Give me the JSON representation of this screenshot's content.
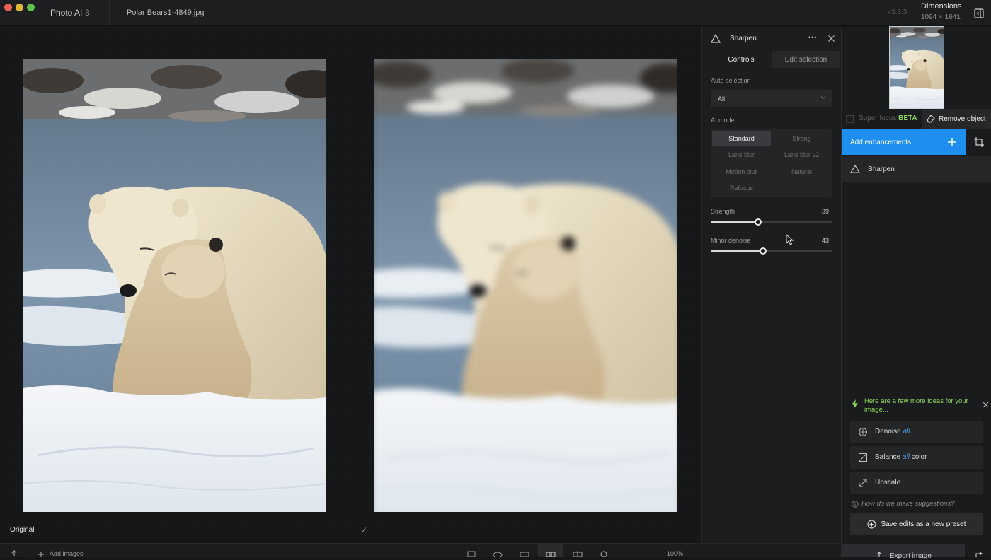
{
  "titlebar": {
    "app_name": "Photo AI",
    "image_count": "3",
    "file_name": "Polar Bears1-4849.jpg",
    "version": "v3.3.3",
    "dimensions_label": "Dimensions",
    "dimensions_value": "1094 × 1641"
  },
  "canvas": {
    "original_label": "Original",
    "check": "✓"
  },
  "bottombar": {
    "add_images": "Add images",
    "zoom": "100%"
  },
  "sharpen_panel": {
    "title": "Sharpen",
    "more": "•••",
    "tabs": {
      "controls": "Controls",
      "edit_selection": "Edit selection"
    },
    "auto_selection_label": "Auto selection",
    "auto_selection_value": "All",
    "ai_model_label": "AI model",
    "models": [
      "Standard",
      "Strong",
      "Lens blur",
      "Lens blur v2",
      "Motion blur",
      "Natural",
      "Refocus"
    ],
    "selected_model": "Standard",
    "strength_label": "Strength",
    "strength_value": "39",
    "strength_level": 0.39,
    "denoise_label": "Minor denoise",
    "denoise_value": "43",
    "denoise_level": 0.43
  },
  "right_panel": {
    "super_focus": "Super focus",
    "beta": "BETA",
    "remove_object": "Remove object",
    "add_enhancements": "Add enhancements",
    "enhancement_item": "Sharpen",
    "ideas_title": "Here are a few more ideas for your image...",
    "ideas": [
      {
        "label": "Denoise",
        "tag": "all",
        "suffix": "",
        "icon": "denoise-icon"
      },
      {
        "label": "Balance",
        "tag": "all",
        "suffix": "color",
        "icon": "balance-color-icon"
      },
      {
        "label": "Upscale",
        "tag": "",
        "suffix": "",
        "icon": "upscale-icon"
      }
    ],
    "how_text": "How do we make suggestions?",
    "save_preset": "Save edits as a new preset",
    "export": "Export image"
  },
  "colors": {
    "accent": "#1f8fef",
    "ideas_green": "#8fd65c",
    "tag_blue": "#4fa3f0"
  }
}
